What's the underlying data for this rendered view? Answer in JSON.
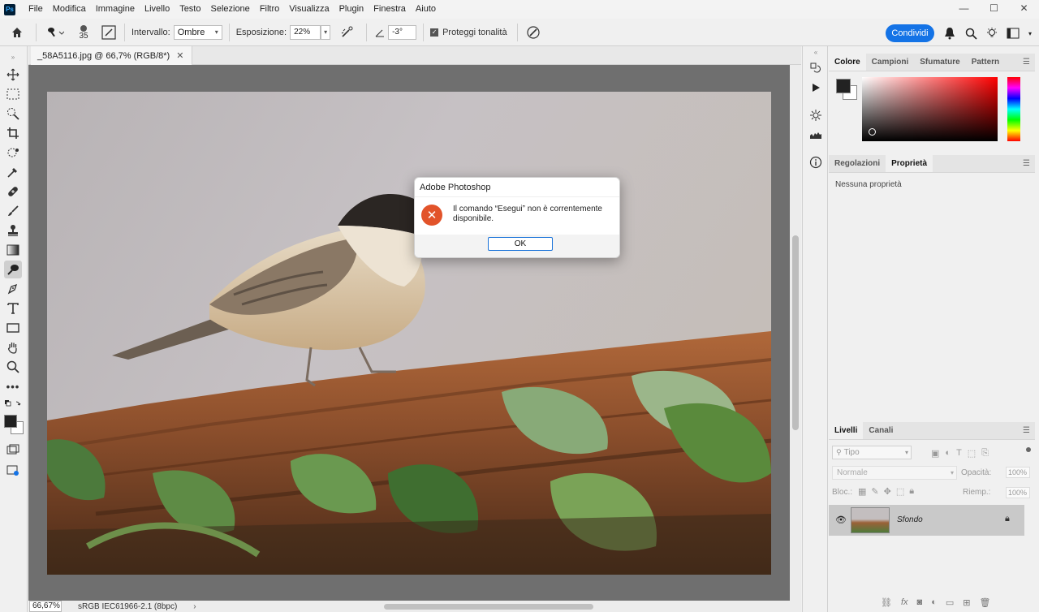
{
  "app": {
    "logo": "Ps",
    "menu": [
      "File",
      "Modifica",
      "Immagine",
      "Livello",
      "Testo",
      "Selezione",
      "Filtro",
      "Visualizza",
      "Plugin",
      "Finestra",
      "Aiuto"
    ],
    "window_controls": [
      "minimize-icon",
      "maximize-icon",
      "close-icon"
    ]
  },
  "options": {
    "brush_size": "35",
    "intervallo_label": "Intervallo:",
    "intervallo_value": "Ombre",
    "esposizione_label": "Esposizione:",
    "esposizione_value": "22%",
    "angle_value": "-3°",
    "proteggi_label": "Proteggi tonalità",
    "proteggi_checked": true,
    "share_label": "Condividi"
  },
  "document": {
    "tab_title": "_58A5116.jpg @ 66,7% (RGB/8*)",
    "zoom": "66,67%",
    "profile": "sRGB IEC61966-2.1 (8bpc)",
    "status_arrow": "›"
  },
  "color_panel": {
    "tabs": [
      "Colore",
      "Campioni",
      "Sfumature",
      "Pattern"
    ],
    "active_tab": "Colore",
    "foreground": "#222222",
    "background": "#ffffff",
    "hue": "#ff0000"
  },
  "properties_panel": {
    "tabs": [
      "Regolazioni",
      "Proprietà"
    ],
    "active_tab": "Proprietà",
    "empty_text": "Nessuna proprietà"
  },
  "layers_panel": {
    "tabs": [
      "Livelli",
      "Canali"
    ],
    "active_tab": "Livelli",
    "filter_placeholder": "Tipo",
    "blend_mode": "Normale",
    "opacity_label": "Opacità:",
    "opacity_value": "100%",
    "lock_label": "Bloc.:",
    "fill_label": "Riemp.:",
    "fill_value": "100%",
    "layers": [
      {
        "name": "Sfondo",
        "visible": true,
        "locked": true
      }
    ]
  },
  "dialog": {
    "title": "Adobe Photoshop",
    "message": "Il comando “Esegui” non è correntemente disponibile.",
    "ok_label": "OK"
  }
}
